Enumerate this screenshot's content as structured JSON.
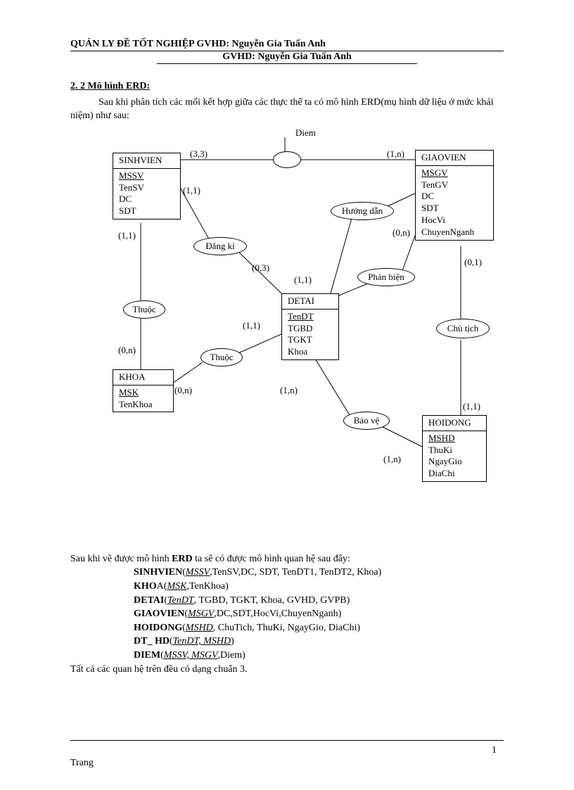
{
  "header": {
    "line1": "QUẢN LY ĐỀ TỐT NGHIỆP GVHD: Nguyễn Gia Tuấn Anh",
    "line2": "GVHD: Nguyễn Gia Tuấn Anh"
  },
  "section": {
    "title": "2. 2 Mô hình ERD:",
    "intro": "Sau khi phân tích các mối kết hợp giữa các thực thể ta có mô hình ERD(mụ hình dữ liệu ở mức khái niệm) như sau:"
  },
  "entities": {
    "sinhvien": {
      "title": "SINHVIEN",
      "attrs": [
        "MSSV",
        "TenSV",
        "DC",
        "SDT"
      ],
      "pkIndex": 0
    },
    "giaovien": {
      "title": "GIAOVIEN",
      "attrs": [
        "MSGV",
        "TenGV",
        "DC",
        "SDT",
        "HocVi",
        "ChuyenNganh"
      ],
      "pkIndex": 0
    },
    "detai": {
      "title": "DETAI",
      "attrs": [
        "TenDT",
        "TGBD",
        "TGKT",
        "Khoa"
      ],
      "pkIndex": 0
    },
    "khoa": {
      "title": "KHOA",
      "attrs": [
        "MSK",
        "TenKhoa"
      ],
      "pkIndex": 0
    },
    "hoidong": {
      "title": "HOIDONG",
      "attrs": [
        "MSHD",
        "ThuKi",
        "NgayGio",
        "DiaChi"
      ],
      "pkIndex": 0
    }
  },
  "relationships": {
    "diem_attr": "Diem",
    "dangki": "Đăng kí",
    "huongdan": "Hướng dẫn",
    "phanbien": "Phản biện",
    "thuoc1": "Thuộc",
    "thuoc2": "Thuộc",
    "chutich": "Chủ tịch",
    "baove": "Bảo vệ"
  },
  "cards": {
    "c33": "(3,3)",
    "c1n_top": "(1,n)",
    "c11_sv": "(1,1)",
    "c11_svthuoc": "(1,1)",
    "c0n_khoa": "(0,n)",
    "c0n_khoa2": "(0,n)",
    "c11_dt": "(1,1)",
    "c03": "(0,3)",
    "c11_hd": "(1,1)",
    "c0n_gv": "(0,n)",
    "c01": "(0,1)",
    "c1n_bv": "(1,n)",
    "c1n_bv2": "(1,n)",
    "c11_ho": "(1,1)"
  },
  "after": {
    "lead": "Sau khi vẽ được mô hình ",
    "erd": "ERD",
    "lead2": " ta sẽ có được mô hình quan hệ sau đây:",
    "r1_name": "SINHVIEN",
    "r1_key": "MSSV",
    "r1_rest": ",TenSV,DC, SDT, TenDT1, TenDT2, Khoa)",
    "r2_name": "KHO",
    "r2_a": "A(",
    "r2_key": "MSK",
    "r2_rest": ",TenKhoa)",
    "r3_name": "DETAI",
    "r3_key": "TenDT",
    "r3_rest": ", TGBD, TGKT, Khoa, GVHD, GVPB)",
    "r4_name": "GIAOVIEN",
    "r4_key": "MSGV",
    "r4_rest": ",DC,SDT,HocVi,ChuyenNganh)",
    "r5_name": "HOIDONG",
    "r5_key": "MSHD",
    "r5_rest": ", ChuTich, ThuKi, NgayGio, DiaChi)",
    "r6_name": "DT_ HD",
    "r6_key": "TenDT, MSHD",
    "r6_rest": ")",
    "r7_name": "DIEM",
    "r7_key": "MSSV, MSGV",
    "r7_rest": ",Diem)",
    "closing": "Tất cả các quan hệ trên đều có dạng chuẩn 3."
  },
  "footer": {
    "page": "1",
    "trang": "Trang"
  }
}
